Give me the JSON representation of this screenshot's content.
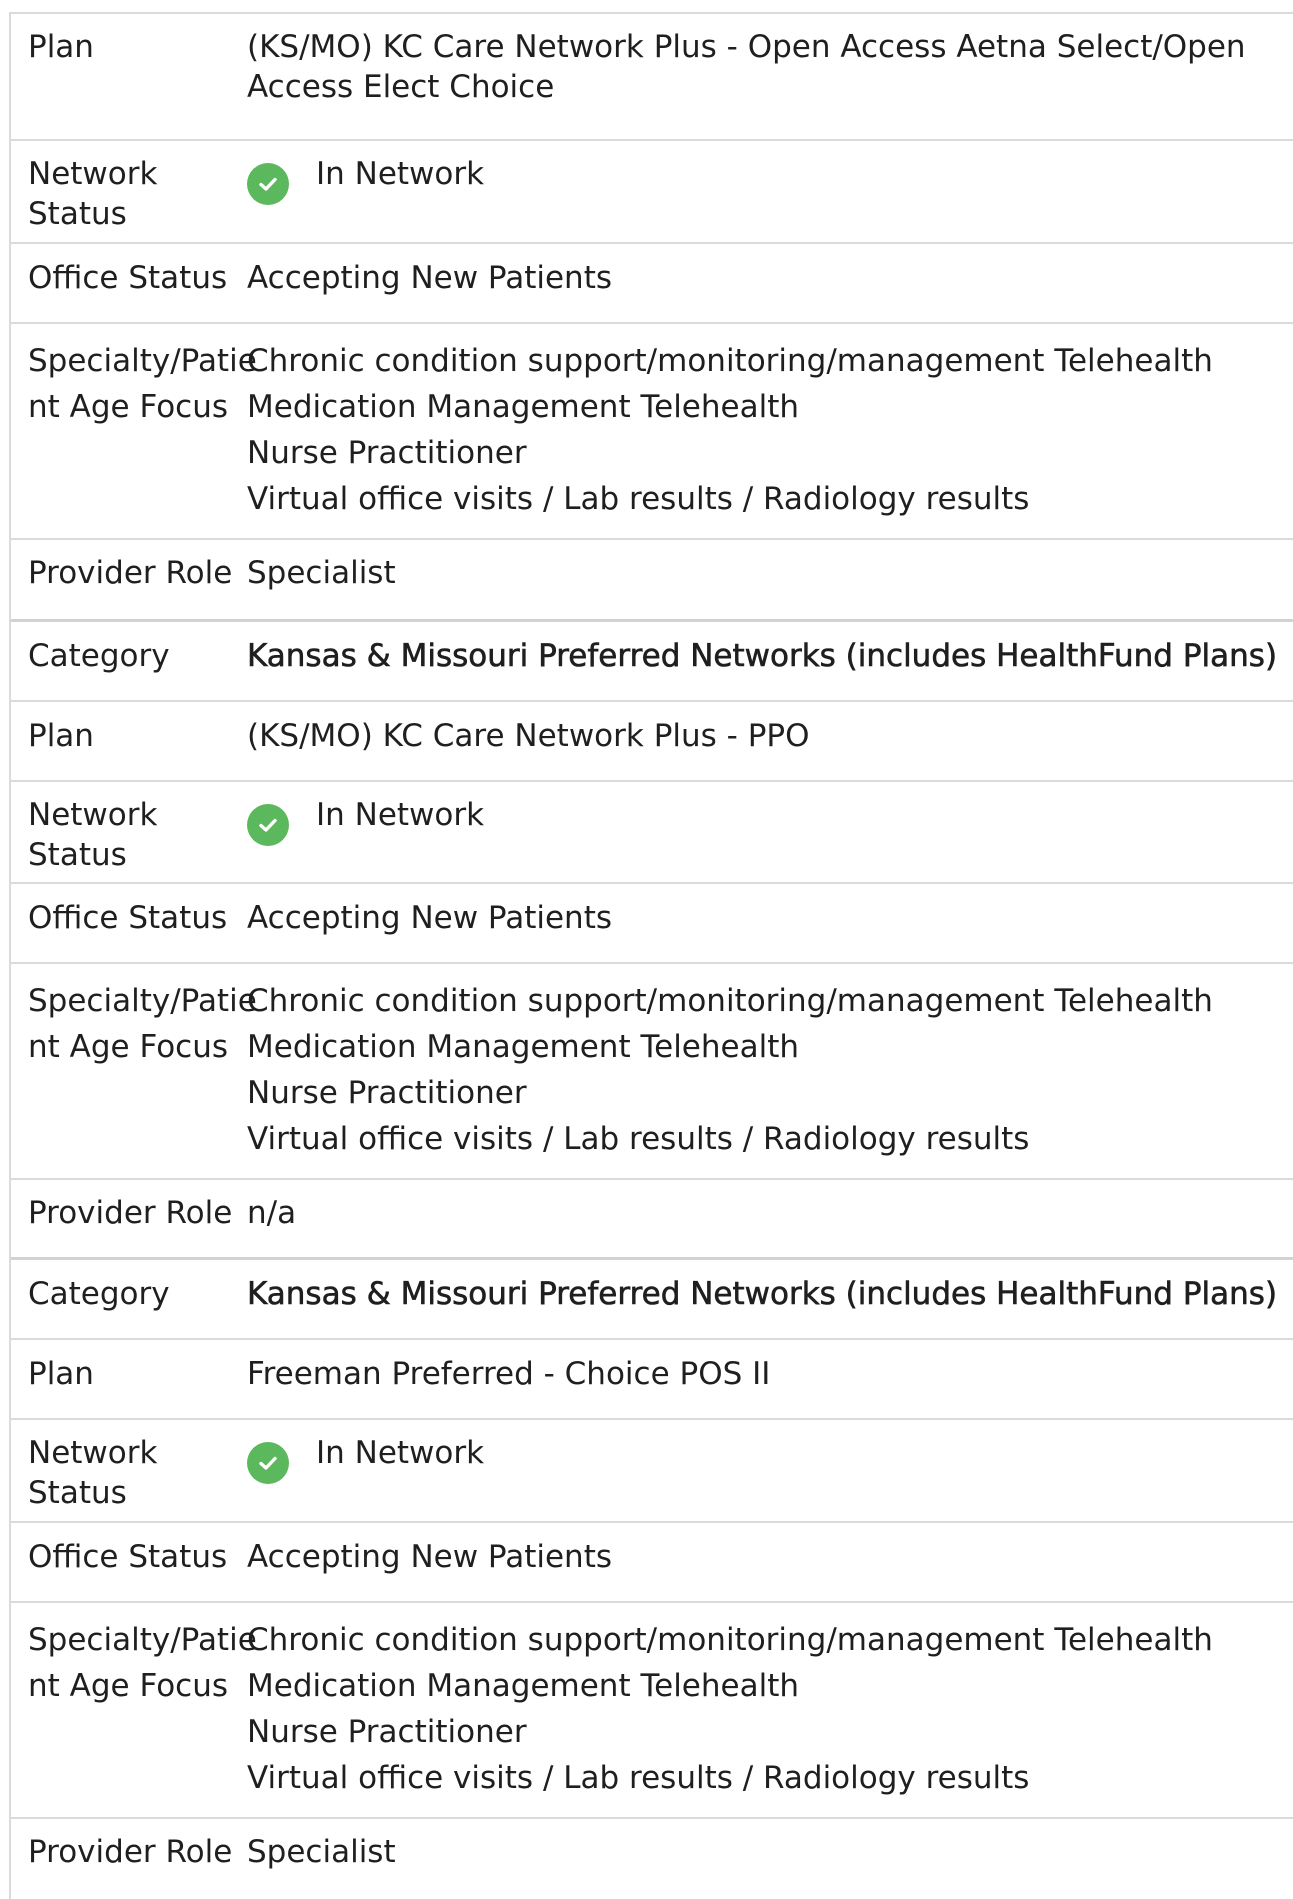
{
  "labels": {
    "category": "Category",
    "plan": "Plan",
    "network_status": "Network Status",
    "office_status": "Office Status",
    "specialty": "Specialty/Patient Age Focus",
    "specialty_line1": "Specialty/Patie",
    "specialty_line2": "nt Age Focus",
    "provider_role": "Provider Role"
  },
  "blocks": [
    {
      "plan_line1": "(KS/MO) KC Care Network Plus - Open Access Aetna Select/Open",
      "plan_line2": "Access Elect Choice",
      "network_status": "In Network",
      "office_status": "Accepting New Patients",
      "specialties": [
        "Chronic condition support/monitoring/management Telehealth",
        "Medication Management Telehealth",
        "Nurse Practitioner",
        "Virtual office visits / Lab results / Radiology results"
      ],
      "provider_role": "Specialist"
    },
    {
      "category": "Kansas & Missouri Preferred Networks (includes HealthFund Plans)",
      "plan": "(KS/MO) KC Care Network Plus - PPO",
      "network_status": "In Network",
      "office_status": "Accepting New Patients",
      "specialties": [
        "Chronic condition support/monitoring/management Telehealth",
        "Medication Management Telehealth",
        "Nurse Practitioner",
        "Virtual office visits / Lab results / Radiology results"
      ],
      "provider_role": "n/a"
    },
    {
      "category": "Kansas & Missouri Preferred Networks (includes HealthFund Plans)",
      "plan": "Freeman Preferred - Choice POS II",
      "network_status": "In Network",
      "office_status": "Accepting New Patients",
      "specialties": [
        "Chronic condition support/monitoring/management Telehealth",
        "Medication Management Telehealth",
        "Nurse Practitioner",
        "Virtual office visits / Lab results / Radiology results"
      ],
      "provider_role": "Specialist"
    }
  ],
  "colors": {
    "check_green": "#5cb85c",
    "divider": "#dadada"
  },
  "icons": {
    "network_status": "check-circle-icon"
  }
}
